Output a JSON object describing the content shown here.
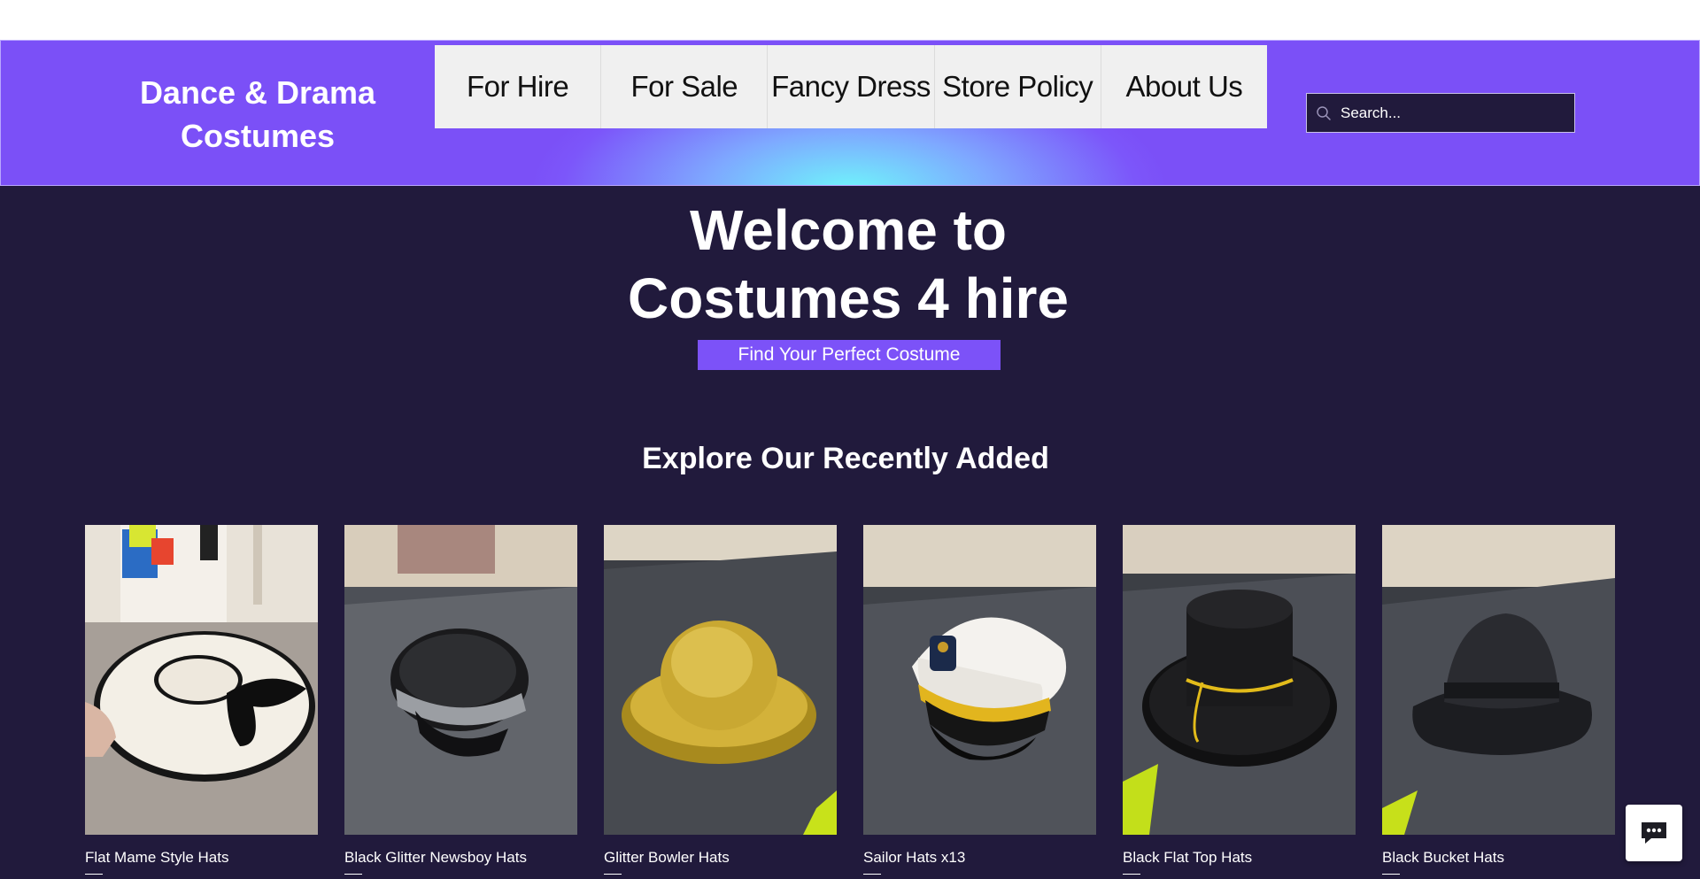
{
  "site": {
    "logo_line1": "Dance & Drama",
    "logo_line2": "Costumes"
  },
  "nav": {
    "items": [
      {
        "label": "For Hire"
      },
      {
        "label": "For Sale"
      },
      {
        "label": "Fancy Dress"
      },
      {
        "label": "Store Policy"
      },
      {
        "label": "About Us"
      }
    ]
  },
  "search": {
    "placeholder": "Search...",
    "icon": "search-icon"
  },
  "hero": {
    "title_line1": "Welcome to",
    "title_line2": "Costumes 4 hire",
    "cta_label": "Find Your Perfect Costume"
  },
  "recent": {
    "title": "Explore Our Recently Added",
    "products": [
      {
        "name": "Flat Mame Style Hats"
      },
      {
        "name": "Black Glitter Newsboy Hats"
      },
      {
        "name": "Glitter Bowler Hats"
      },
      {
        "name": "Sailor Hats x13"
      },
      {
        "name": "Black Flat Top Hats"
      },
      {
        "name": "Black Bucket Hats"
      }
    ]
  },
  "chat": {
    "icon": "chat-icon"
  },
  "colors": {
    "page_bg": "#211a3c",
    "header_purple": "#7b50f7",
    "header_cyan": "#6ff6fb",
    "cta_purple": "#7c52f8",
    "nav_bg": "#f0f0f0"
  }
}
